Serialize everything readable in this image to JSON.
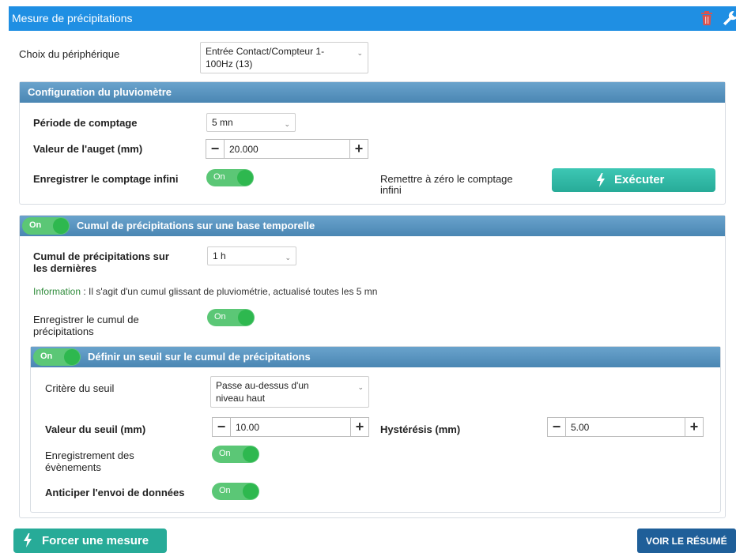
{
  "header": {
    "title": "Mesure de précipitations",
    "delete_icon": "trash-icon",
    "settings_icon": "wrench-icon"
  },
  "device": {
    "label": "Choix du périphérique",
    "value_line1": "Entrée Contact/Compteur 1-",
    "value_line2": "100Hz (13)"
  },
  "rain_gauge": {
    "title": "Configuration du pluviomètre",
    "period_label": "Période de comptage",
    "period_value": "5 mn",
    "bucket_label": "Valeur de l'auget (mm)",
    "bucket_value": "20.000",
    "infinite_label": "Enregistrer le comptage infini",
    "infinite_toggle": "On",
    "reset_label_line1": "Remettre à zéro le comptage",
    "reset_label_line2": "infini",
    "execute_label": "Exécuter"
  },
  "cumul": {
    "toggle": "On",
    "title": "Cumul de précipitations sur une base temporelle",
    "last_label_line1": "Cumul de précipitations sur",
    "last_label_line2": "les dernières",
    "last_value": "1 h",
    "info_key": "Information",
    "info_text": " : Il s'agit d'un cumul glissant de pluviométrie, actualisé toutes les 5 mn",
    "record_label_line1": "Enregistrer le cumul de",
    "record_label_line2": "précipitations",
    "record_toggle": "On"
  },
  "threshold": {
    "toggle": "On",
    "title": "Définir un seuil sur le cumul de précipitations",
    "criterion_label": "Critère du seuil",
    "criterion_line1": "Passe au-dessus d'un",
    "criterion_line2": "niveau haut",
    "value_label": "Valeur du seuil (mm)",
    "value": "10.00",
    "hyst_label": "Hystérésis (mm)",
    "hyst_value": "5.00",
    "events_label_line1": "Enregistrement des",
    "events_label_line2": "évènements",
    "events_toggle": "On",
    "anticipate_label": "Anticiper l'envoi de données",
    "anticipate_toggle": "On"
  },
  "footer": {
    "force_label": "Forcer une mesure",
    "resume_label": "VOIR LE RÉSUMÉ"
  },
  "colors": {
    "header": "#1f8fe3",
    "band": "#4a86b3",
    "toggle": "#5bc776",
    "action": "#27ab98",
    "resume": "#1f5f99",
    "trash": "#d9534f"
  }
}
